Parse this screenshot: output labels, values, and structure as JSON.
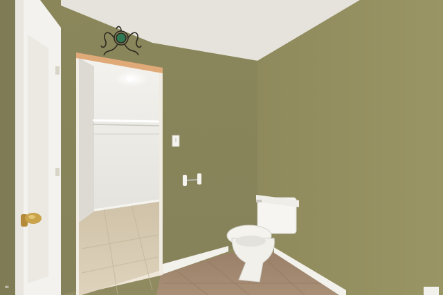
{
  "scene": {
    "description_colors": {
      "ceiling": "#e6e3dc",
      "wall_left": "#8d8a5e",
      "wall_right": "#938e60",
      "closet_interior": "#ecebe6",
      "floor_tile": "#a48b72",
      "closet_floor": "#d9ccb4",
      "door": "#f4f2ee",
      "baseboard": "#f3f1ec",
      "toilet": "#f6f5f1",
      "door_knob": "#c9a24a"
    }
  },
  "watermark": {
    "icon": "infinity-logo-icon"
  }
}
